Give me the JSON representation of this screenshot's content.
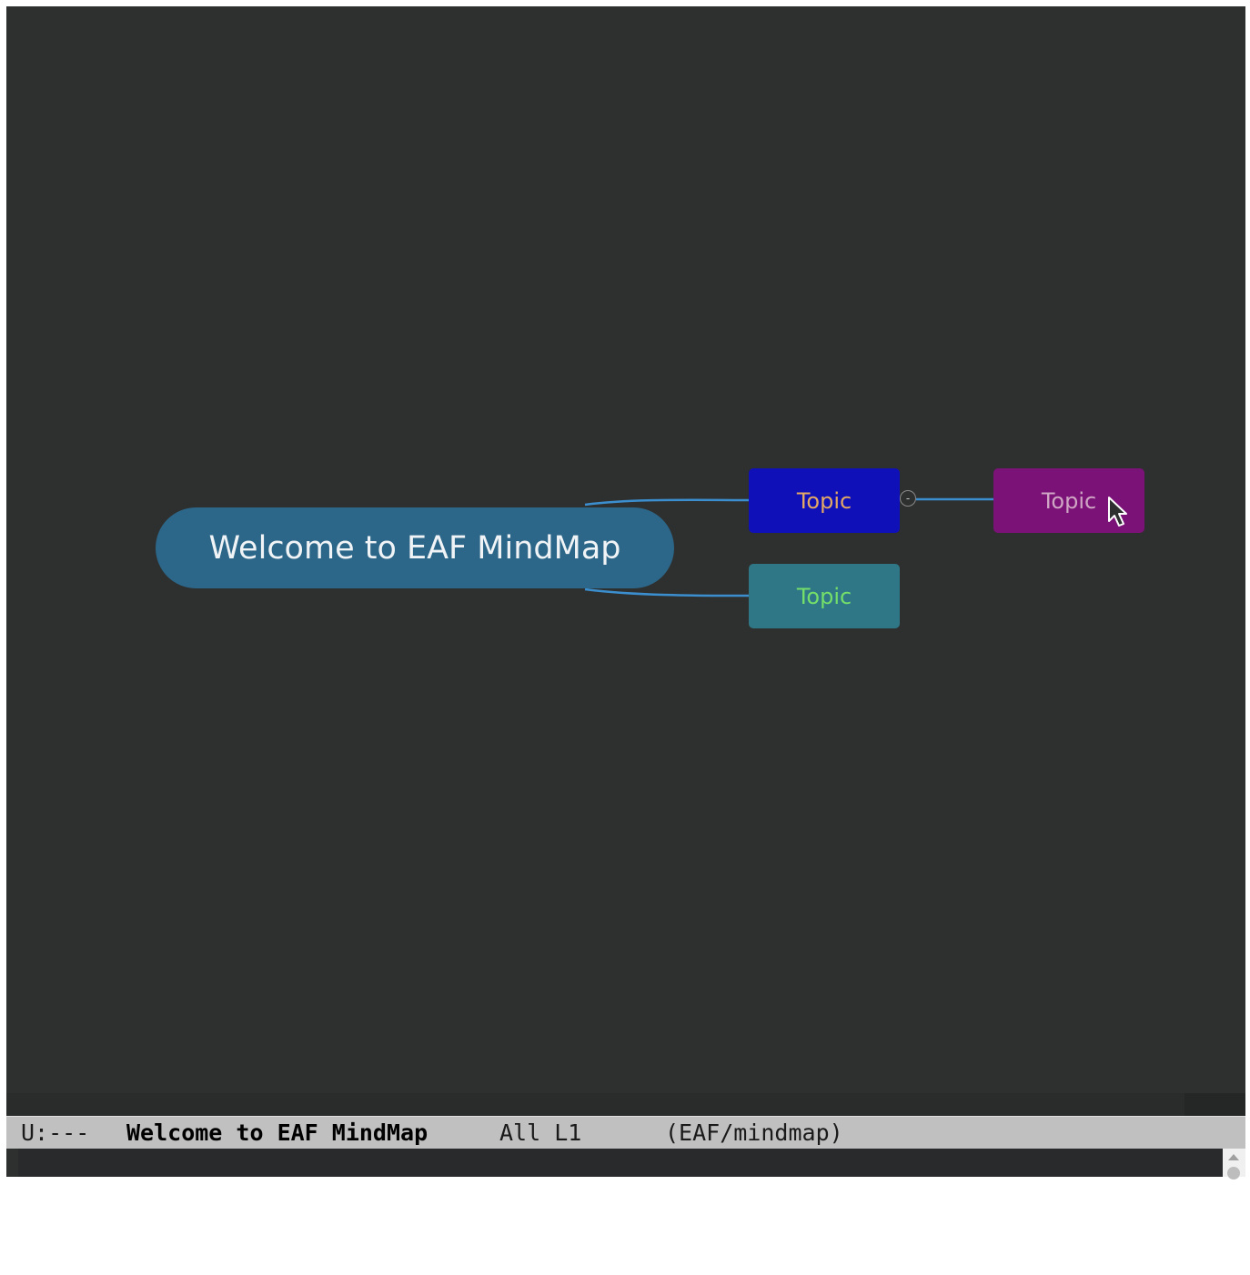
{
  "mindmap": {
    "root_label": "Welcome to EAF MindMap",
    "topics": [
      {
        "label": "Topic",
        "bg_color": "#1010b8",
        "text_color": "#e3a865"
      },
      {
        "label": "Topic",
        "bg_color": "#2f7786",
        "text_color": "#74de6a"
      },
      {
        "label": "Topic",
        "bg_color": "#7b1277",
        "text_color": "#cfa7c5"
      }
    ],
    "collapse_symbol": "-",
    "connector_color": "#3b8fcf",
    "root_color": "#2c6688",
    "background_color": "#2e2f2f"
  },
  "mode_line": {
    "status": "U:---",
    "buffer_name": "Welcome to EAF MindMap",
    "position": "All L1",
    "major_mode": "(EAF/mindmap)"
  },
  "icons": {
    "cursor": "mouse-pointer-icon",
    "scroll_up": "scroll-up-arrow-icon"
  }
}
